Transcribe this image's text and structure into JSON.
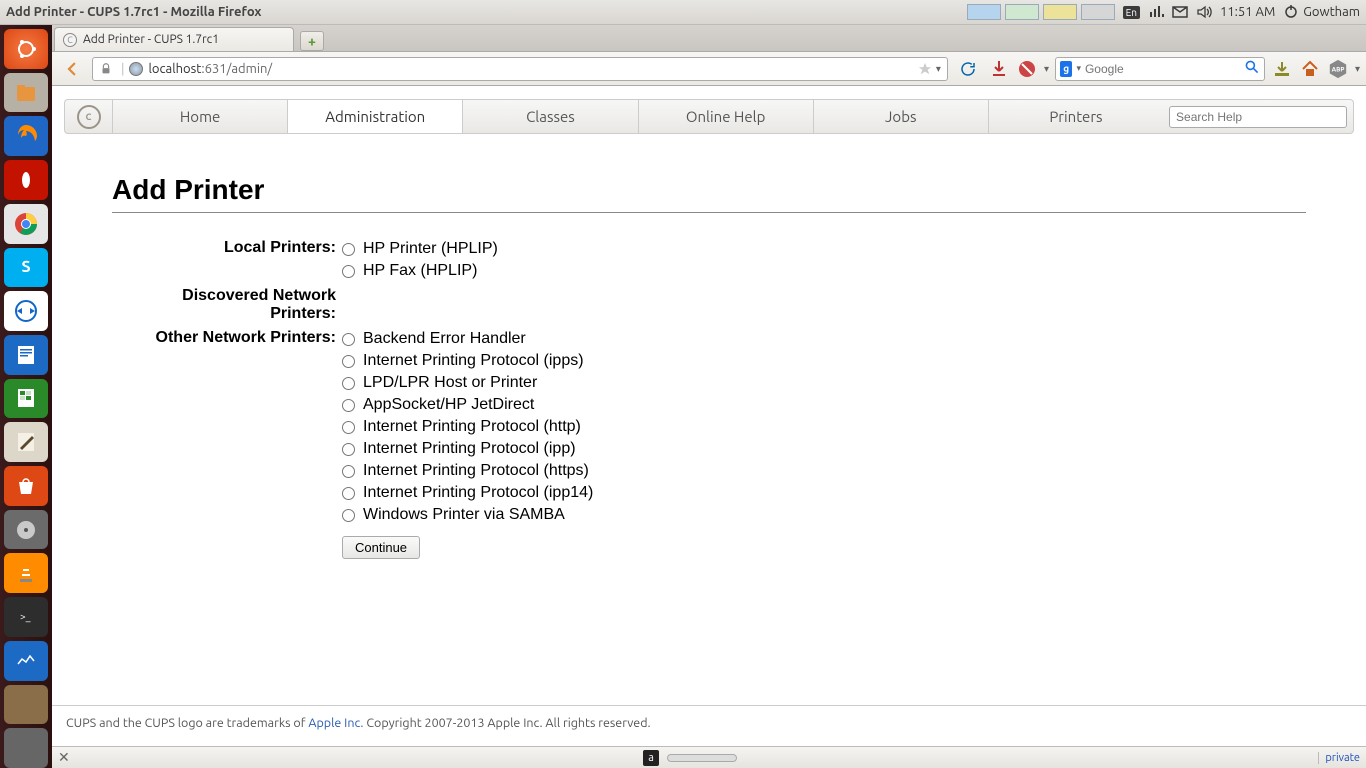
{
  "menubar": {
    "window_title": "Add Printer - CUPS 1.7rc1 - Mozilla Firefox",
    "lang_badge": "En",
    "time": "11:51 AM",
    "user": "Gowtham"
  },
  "tab": {
    "title": "Add Printer - CUPS 1.7rc1"
  },
  "url": {
    "host": "localhost",
    "port": ":631",
    "path": "/admin/"
  },
  "searchbar": {
    "placeholder": "Google",
    "engine_letter": "g"
  },
  "cups_nav": {
    "items": [
      "Home",
      "Administration",
      "Classes",
      "Online Help",
      "Jobs",
      "Printers"
    ],
    "active_index": 1,
    "search_placeholder": "Search Help"
  },
  "page": {
    "heading": "Add Printer",
    "sections": {
      "local_label": "Local Printers:",
      "local": [
        "HP Printer (HPLIP)",
        "HP Fax (HPLIP)"
      ],
      "discovered_label": "Discovered Network Printers:",
      "other_label": "Other Network Printers:",
      "other": [
        "Backend Error Handler",
        "Internet Printing Protocol (ipps)",
        "LPD/LPR Host or Printer",
        "AppSocket/HP JetDirect",
        "Internet Printing Protocol (http)",
        "Internet Printing Protocol (ipp)",
        "Internet Printing Protocol (https)",
        "Internet Printing Protocol (ipp14)",
        "Windows Printer via SAMBA"
      ]
    },
    "continue_label": "Continue"
  },
  "footer": {
    "pre": "CUPS and the CUPS logo are trademarks of ",
    "link": "Apple Inc.",
    "post": " Copyright 2007-2013 Apple Inc. All rights reserved."
  },
  "addonbar": {
    "private": "private"
  }
}
